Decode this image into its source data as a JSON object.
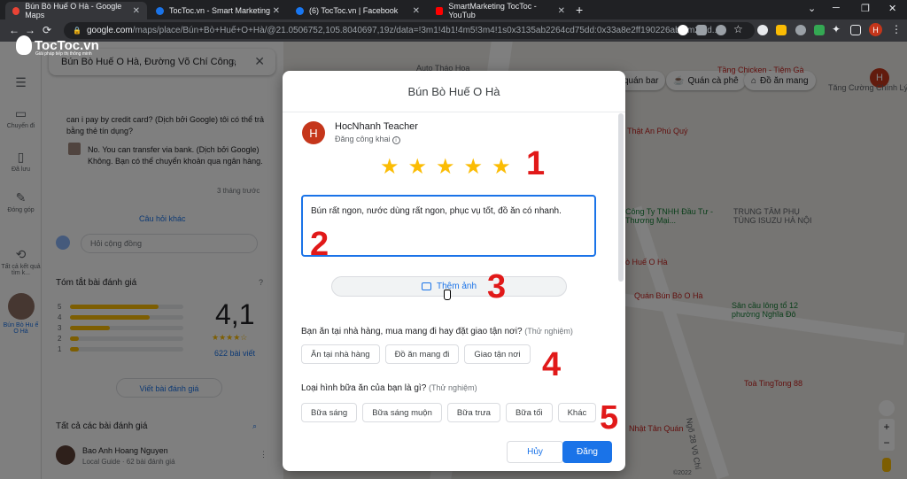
{
  "browser": {
    "tabs": [
      {
        "title": "Bún Bò Huế O Hà - Google Maps",
        "color": "#ea4335",
        "active": true
      },
      {
        "title": "TocToc.vn - Smart Marketing",
        "color": "#1a73e8",
        "active": false
      },
      {
        "title": "(6) TocToc.vn | Facebook",
        "color": "#1877f2",
        "active": false
      },
      {
        "title": "SmartMarketing TocToc - YouTub",
        "color": "#ff0000",
        "active": false
      }
    ],
    "url_domain": "google.com",
    "url_rest": "/maps/place/Bún+Bò+Huế+O+Hà/@21.0506752,105.8040697,19z/data=!3m1!4b1!4m5!3m4!1s0x3135ab2264cd75dd:0x33a8e2ff190226ab!8m2!3d...",
    "profile_initial": "H"
  },
  "logo": {
    "name": "TocToc.vn",
    "tagline": "Giải pháp tiếp thị thông minh"
  },
  "rail": [
    {
      "icon": "🚌",
      "label": "Chuyến đi"
    },
    {
      "icon": "🔖",
      "label": "Đã lưu"
    },
    {
      "icon": "✎",
      "label": "Đóng góp"
    },
    {
      "icon": "⟲",
      "label": "Tất cả kết quả tìm k..."
    },
    {
      "label": "Bún Bò Hu ế O Hà"
    }
  ],
  "sidebar": {
    "search_value": "Bún Bò Huế O Hà, Đường Võ Chí Công,",
    "question": "can i pay by credit card? (Dịch bởi Google) tôi có thể trả bằng thẻ tín dụng?",
    "answer": "No. You can transfer via bank. (Dịch bởi Google) Không. Bạn có thể chuyển khoản qua ngân hàng.",
    "answer_time": "3 tháng trước",
    "more_questions": "Câu hỏi khác",
    "ask_placeholder": "Hỏi cộng đồng",
    "summary_title": "Tóm tắt bài đánh giá",
    "rating": "4,1",
    "review_count": "622 bài viết",
    "write_review": "Viết bài đánh giá",
    "all_reviews": "Tất cả các bài đánh giá",
    "reviewer_name": "Bao Anh Hoang Nguyen",
    "reviewer_meta": "Local Guide · 62 bài đánh giá",
    "bars": [
      {
        "star": "5",
        "pct": 0.78
      },
      {
        "star": "4",
        "pct": 0.7
      },
      {
        "star": "3",
        "pct": 0.35
      },
      {
        "star": "2",
        "pct": 0.08
      },
      {
        "star": "1",
        "pct": 0.08
      }
    ]
  },
  "map": {
    "chips": [
      {
        "label": "quán bar"
      },
      {
        "label": "Quán cà phê"
      },
      {
        "label": "Đồ ăn mang"
      }
    ],
    "labels": [
      {
        "text": "Auto Tháo Hoa",
        "kind": "gray"
      },
      {
        "text": "Tầng Chicken - Tiệm Gà",
        "kind": "red"
      },
      {
        "text": "Tăng Cường Chính Lý T",
        "kind": "gray"
      },
      {
        "text": "Thật An Phú Quý",
        "kind": "red"
      },
      {
        "text": "TRUNG TÂM PHỤ TÙNG ISUZU HÀ NỘI",
        "kind": "gray"
      },
      {
        "text": "Công Ty TNHH Đầu Tư - Thương Mại...",
        "kind": "green"
      },
      {
        "text": "ò Huế O Hà",
        "kind": "red"
      },
      {
        "text": "Quán Bún Bò O Hà",
        "kind": "red"
      },
      {
        "text": "Sân cầu lông tổ 12 phường Nghĩa Đô",
        "kind": "green"
      },
      {
        "text": "Toà TingTong 88",
        "kind": "red"
      },
      {
        "text": "Nhật Tân Quán",
        "kind": "red"
      },
      {
        "text": "Ngõ 28 Võ Chí",
        "kind": "gray"
      },
      {
        "text": "©2022",
        "kind": "gray"
      }
    ]
  },
  "dialog": {
    "title": "Bún Bò Huế O Hà",
    "user_initial": "H",
    "user_name": "HocNhanh Teacher",
    "visibility": "Đăng công khai",
    "stars": [
      "★",
      "★",
      "★",
      "★",
      "★"
    ],
    "review_text": "Bún rất ngon, nước dùng rất ngon, phục vụ tốt, đồ ăn có nhanh.",
    "add_photo": "Thêm ảnh",
    "q1": "Bạn ăn tại nhà hàng, mua mang đi hay đặt giao tận nơi?",
    "q1_tag": "(Thử nghiệm)",
    "q1_options": [
      "Ăn tại nhà hàng",
      "Đồ ăn mang đi",
      "Giao tận nơi"
    ],
    "q2": "Loại hình bữa ăn của bạn là gì?",
    "q2_tag": "(Thử nghiệm)",
    "q2_options": [
      "Bữa sáng",
      "Bữa sáng muộn",
      "Bữa trưa",
      "Bữa tối",
      "Khác"
    ],
    "cancel": "Hủy",
    "post": "Đăng"
  },
  "annotations": [
    "1",
    "2",
    "3",
    "4",
    "5"
  ],
  "colors": {
    "accent": "#1a73e8",
    "star": "#fbbc04",
    "annotation": "#e11919"
  }
}
